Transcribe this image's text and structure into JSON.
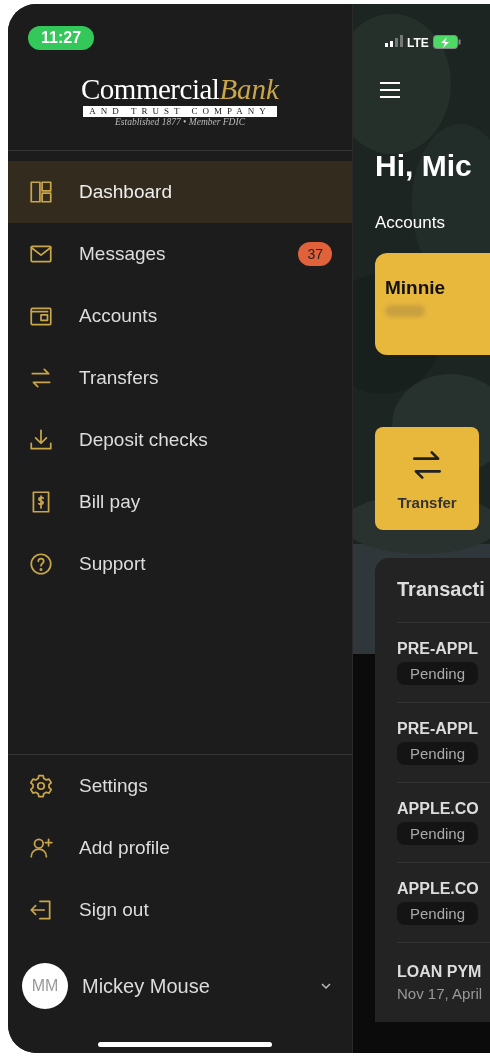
{
  "status_bar": {
    "time": "11:27",
    "network": "LTE",
    "charging": true
  },
  "logo": {
    "name_1": "Commercial",
    "name_2": "Bank",
    "tagline": "AND TRUST COMPANY",
    "subline": "Established 1877 • Member FDIC"
  },
  "nav": [
    {
      "label": "Dashboard",
      "selected": true
    },
    {
      "label": "Messages",
      "selected": false,
      "badge": "37"
    },
    {
      "label": "Accounts",
      "selected": false
    },
    {
      "label": "Transfers",
      "selected": false
    },
    {
      "label": "Deposit checks",
      "selected": false
    },
    {
      "label": "Bill pay",
      "selected": false
    },
    {
      "label": "Support",
      "selected": false
    }
  ],
  "footer_nav": [
    {
      "label": "Settings"
    },
    {
      "label": "Add profile"
    },
    {
      "label": "Sign out"
    }
  ],
  "user": {
    "initials": "MM",
    "name": "Mickey Mouse"
  },
  "main": {
    "greeting": "Hi, Mic",
    "accounts_label": "Accounts",
    "accounts": [
      {
        "name": "Minnie"
      }
    ],
    "actions": [
      {
        "label": "Transfer"
      }
    ],
    "transactions": {
      "title": "Transacti",
      "rows": [
        {
          "name": "PRE-APPL",
          "status": "Pending"
        },
        {
          "name": "PRE-APPL",
          "status": "Pending"
        },
        {
          "name": "APPLE.CO",
          "status": "Pending"
        },
        {
          "name": "APPLE.CO",
          "status": "Pending"
        },
        {
          "name": "LOAN PYM",
          "date": "Nov 17, April"
        }
      ]
    }
  }
}
